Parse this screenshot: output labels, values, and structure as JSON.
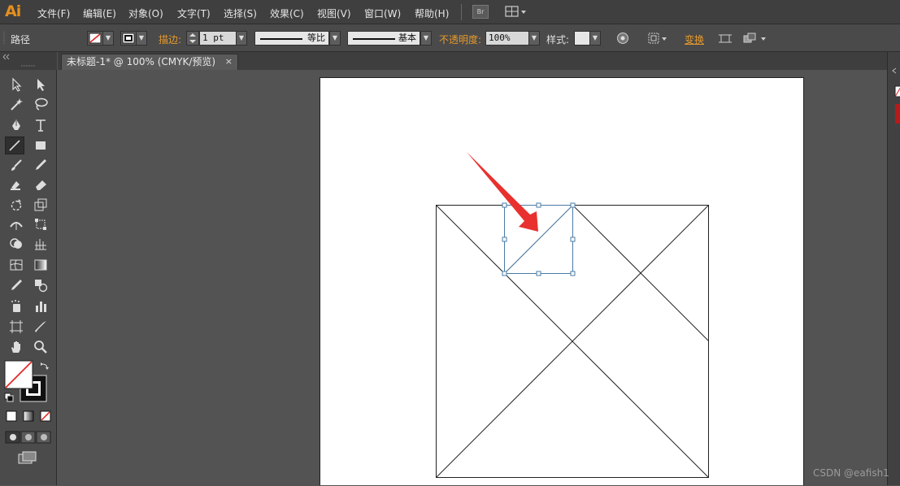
{
  "app": {
    "logo": "Ai"
  },
  "menu": {
    "items": [
      "文件(F)",
      "编辑(E)",
      "对象(O)",
      "文字(T)",
      "选择(S)",
      "效果(C)",
      "视图(V)",
      "窗口(W)",
      "帮助(H)"
    ],
    "bridge_label": "Br"
  },
  "control_bar": {
    "selection_type": "路径",
    "stroke_label": "描边:",
    "stroke_weight": "1 pt",
    "profile_label": "等比",
    "brush_label": "基本",
    "opacity_label": "不透明度:",
    "opacity_value": "100%",
    "style_label": "样式:",
    "transform_label": "变换"
  },
  "document": {
    "tab_title": "未标题-1* @ 100% (CMYK/预览)",
    "close_glyph": "×"
  },
  "colors": {
    "accent": "#e58f1e",
    "selection": "#4a7ba6",
    "arrow": "#e8312e"
  },
  "watermark": "CSDN @eafish1"
}
